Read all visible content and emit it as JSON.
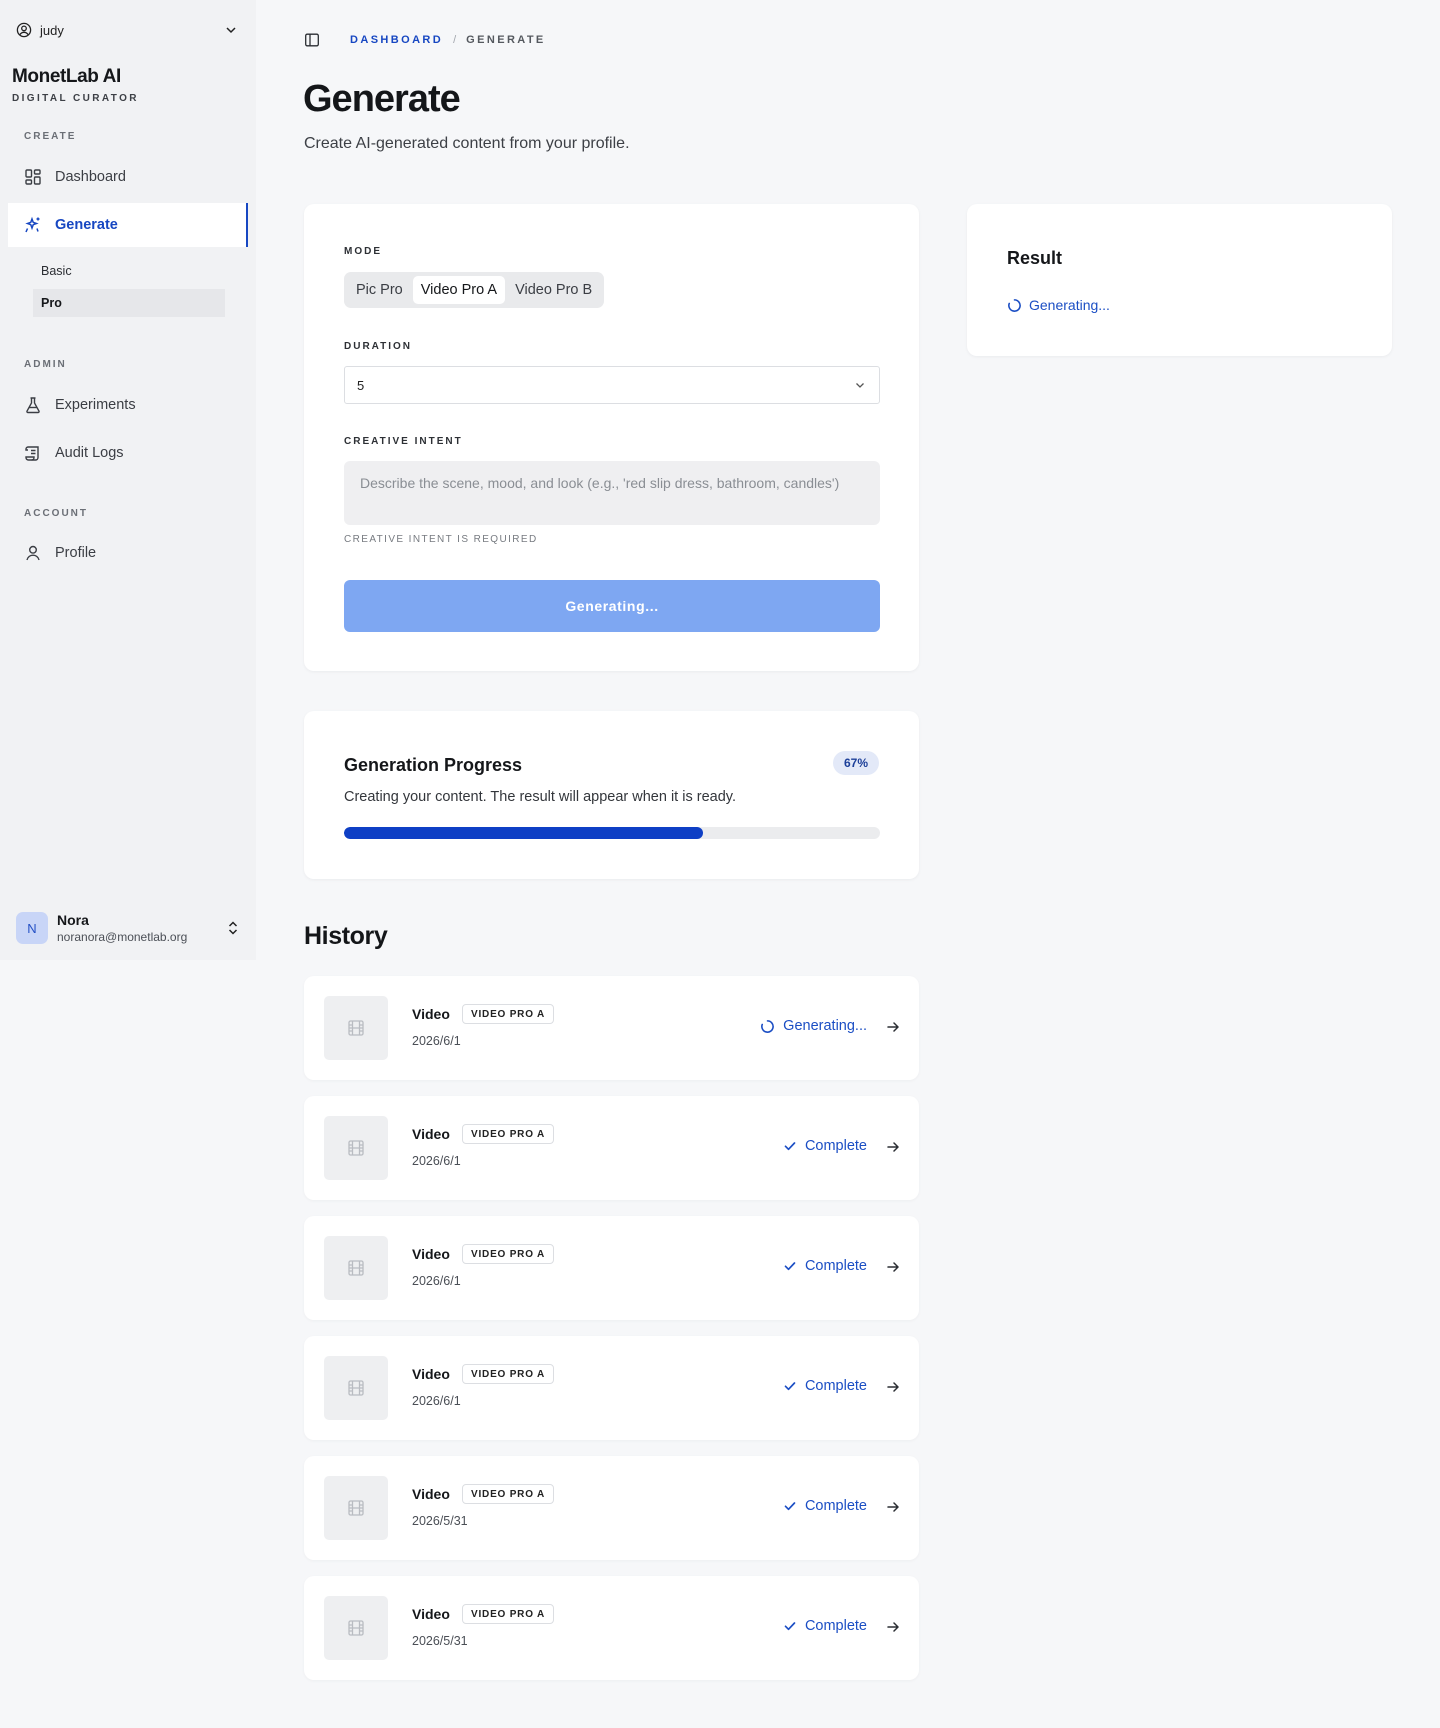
{
  "workspace": {
    "name": "judy"
  },
  "brand": {
    "title": "MonetLab AI",
    "subtitle": "DIGITAL CURATOR"
  },
  "sidebar": {
    "sections": {
      "create": "CREATE",
      "admin": "ADMIN",
      "account": "ACCOUNT"
    },
    "items": {
      "dashboard": "Dashboard",
      "generate": "Generate",
      "basic": "Basic",
      "pro": "Pro",
      "experiments": "Experiments",
      "audit_logs": "Audit Logs",
      "profile": "Profile"
    },
    "user": {
      "initial": "N",
      "name": "Nora",
      "email": "noranora@monetlab.org"
    }
  },
  "breadcrumb": {
    "parent": "DASHBOARD",
    "separator": "/",
    "current": "GENERATE"
  },
  "page": {
    "title": "Generate",
    "subtitle": "Create AI-generated content from your profile."
  },
  "form": {
    "mode_label": "MODE",
    "modes": [
      "Pic Pro",
      "Video Pro A",
      "Video Pro B"
    ],
    "selected_mode": "Video Pro A",
    "duration_label": "DURATION",
    "duration_value": "5",
    "intent_label": "CREATIVE INTENT",
    "intent_placeholder": "Describe the scene, mood, and look (e.g., 'red slip dress, bathroom, candles')",
    "intent_hint": "CREATIVE INTENT IS REQUIRED",
    "submit_label": "Generating..."
  },
  "progress": {
    "title": "Generation Progress",
    "badge": "67%",
    "value": 0.67,
    "description": "Creating your content. The result will appear when it is ready."
  },
  "result": {
    "title": "Result",
    "status": "Generating..."
  },
  "history": {
    "title": "History",
    "items": [
      {
        "name": "Video",
        "tag": "VIDEO PRO A",
        "date": "2026/6/1",
        "status": "Generating..."
      },
      {
        "name": "Video",
        "tag": "VIDEO PRO A",
        "date": "2026/6/1",
        "status": "Complete"
      },
      {
        "name": "Video",
        "tag": "VIDEO PRO A",
        "date": "2026/6/1",
        "status": "Complete"
      },
      {
        "name": "Video",
        "tag": "VIDEO PRO A",
        "date": "2026/6/1",
        "status": "Complete"
      },
      {
        "name": "Video",
        "tag": "VIDEO PRO A",
        "date": "2026/5/31",
        "status": "Complete"
      },
      {
        "name": "Video",
        "tag": "VIDEO PRO A",
        "date": "2026/5/31",
        "status": "Complete"
      }
    ]
  },
  "colors": {
    "accent": "#1747c2",
    "progress_fill": "#0e3fc5",
    "button_disabled": "#7ea7f2",
    "status_text": "#1b4ec4"
  },
  "icons": {
    "workspace": "user-circle-icon",
    "dashboard": "grid-icon",
    "generate": "sparkles-icon",
    "experiments": "flask-icon",
    "audit_logs": "scroll-icon",
    "profile": "user-icon",
    "sidebar_toggle": "panel-left-icon",
    "thumbnail": "film-icon",
    "spinner": "spinner-icon",
    "complete": "check-icon",
    "open": "arrow-right-icon"
  }
}
